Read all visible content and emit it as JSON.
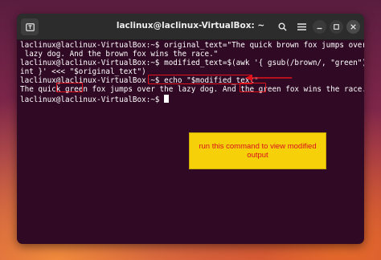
{
  "window": {
    "title": "laclinux@laclinux-VirtualBox: ~"
  },
  "terminal": {
    "lines": [
      "laclinux@laclinux-VirtualBox:~$ original_text=\"The quick brown fox jumps over the",
      " lazy dog. And the brown fox wins the race.\"",
      "laclinux@laclinux-VirtualBox:~$ modified_text=$(awk '{ gsub(/brown/, \"green\"); pr",
      "int }' <<< \"$original_text\")",
      "laclinux@laclinux-VirtualBox:~$ echo \"$modified_text\"",
      "The quick green fox jumps over the lazy dog. And the green fox wins the race.",
      "laclinux@laclinux-VirtualBox:~$ "
    ]
  },
  "annotation": {
    "note_text": "run this command to view modified output",
    "highlight_color": "#e0131b",
    "note_bg": "#f6d10a"
  },
  "colors": {
    "terminal_bg": "#300a24",
    "titlebar_bg": "#2c2c2c"
  },
  "icons": {
    "new_tab": "new-tab-icon",
    "search": "search-icon",
    "menu": "hamburger-menu-icon",
    "minimize": "minimize-icon",
    "maximize": "maximize-icon",
    "close": "close-icon"
  }
}
